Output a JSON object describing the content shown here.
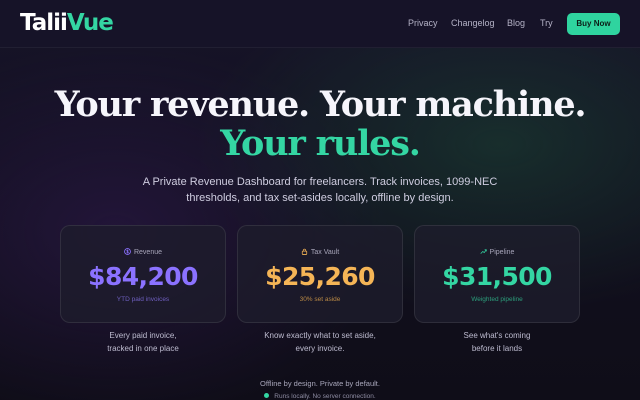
{
  "brand": {
    "part1": "Talii",
    "part2": "Vue"
  },
  "nav": {
    "links": [
      "Privacy",
      "Changelog",
      "Blog",
      "Try"
    ],
    "cta": "Buy Now"
  },
  "hero": {
    "headline_line1": "Your revenue. Your machine.",
    "headline_line2": "Your rules.",
    "subtitle_line1": "A Private Revenue Dashboard for freelancers. Track invoices, 1099-NEC",
    "subtitle_line2": "thresholds, and tax set-asides locally, offline by design."
  },
  "cards": [
    {
      "icon": "dollar-circle-icon",
      "label": "Revenue",
      "value": "$84,200",
      "note": "YTD paid invoices",
      "caption_line1": "Every paid invoice,",
      "caption_line2": "tracked in one place",
      "color": "#8b72ff"
    },
    {
      "icon": "lock-icon",
      "label": "Tax Vault",
      "value": "$25,260",
      "note": "30% set aside",
      "caption_line1": "Know exactly what to set aside,",
      "caption_line2": "every invoice.",
      "color": "#f5b556"
    },
    {
      "icon": "trend-line-icon",
      "label": "Pipeline",
      "value": "$31,500",
      "note": "Weighted pipeline",
      "caption_line1": "See what's coming",
      "caption_line2": "before it lands",
      "color": "#34d6a3"
    }
  ],
  "footer": {
    "tagline": "Offline by design. Private by default.",
    "status": "Runs locally. No server connection."
  },
  "colors": {
    "accent": "#34d6a3",
    "background": "#121020"
  }
}
